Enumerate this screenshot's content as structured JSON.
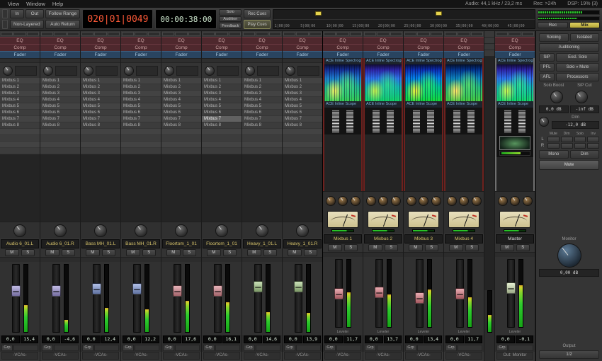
{
  "menubar": {
    "items": [
      "View",
      "Window",
      "Help"
    ],
    "status_audio": "Audio: 44,1 kHz / 23,2 ms",
    "status_rec": "Rec: >24h",
    "status_dsp": "DSP: 19% (3)"
  },
  "toolbar": {
    "punch_in": "In",
    "punch_out": "Out",
    "follow_range": "Follow Range",
    "non_layered": "Non-Layered",
    "auto_return": "Auto Return",
    "primary_clock": "020|01|0049",
    "secondary_clock": "00:00:38:00",
    "solo": "Solo",
    "audition": "Audition",
    "feedback": "Feedback",
    "rec_cues": "Rec Cues",
    "play_cues": "Play Cues",
    "rec_button": "Rec",
    "mix_button": "Mix",
    "ruler_ticks": [
      "1|00|00",
      "5|00|00",
      "10|00|00",
      "15|00|00",
      "20|00|00",
      "25|00|00",
      "30|00|00",
      "35|00|00",
      "40|00|00",
      "45|00|00"
    ]
  },
  "strip_labels": {
    "eq": "EQ",
    "comp": "Comp",
    "fader": "Fader",
    "mute": "M",
    "solo": "S",
    "grp": "Grp",
    "vca": "-VCAs-",
    "gain": "0,0",
    "spectrogram": "ACE Inline Spectrogram",
    "scope": "ACE Inline Scope",
    "leveler": "Leveler"
  },
  "sends": [
    "Mixbus 1",
    "Mixbus 2",
    "Mixbus 3",
    "Mixbus 4",
    "Mixbus 5",
    "Mixbus 6",
    "Mixbus 7",
    "Mixbus 8",
    "",
    "",
    "",
    ""
  ],
  "audio_strips": [
    {
      "name": "Audio 6_01.L",
      "peak": "15,4",
      "cap": "#9a90d4",
      "meter": 40,
      "fader": 30,
      "sel_slot": -1
    },
    {
      "name": "Audio 6_01.R",
      "peak": "-4,6",
      "cap": "#9a90d4",
      "meter": 18,
      "fader": 30,
      "sel_slot": -1
    },
    {
      "name": "Bass MH_01.L",
      "peak": "12,4",
      "cap": "#8098d8",
      "meter": 36,
      "fader": 27,
      "sel_slot": -1
    },
    {
      "name": "Bass MH_01.R",
      "peak": "12,2",
      "cap": "#8098d8",
      "meter": 34,
      "fader": 27,
      "sel_slot": -1
    },
    {
      "name": "Floortom_1_01",
      "peak": "17,6",
      "cap": "#d8838c",
      "meter": 46,
      "fader": 30,
      "sel_slot": -1
    },
    {
      "name": "Floortom_1_01",
      "peak": "16,1",
      "cap": "#d8838c",
      "meter": 44,
      "fader": 30,
      "sel_slot": 6
    },
    {
      "name": "Heavy_1_01.L",
      "peak": "14,6",
      "cap": "#a6cc88",
      "meter": 30,
      "fader": 24,
      "sel_slot": -1
    },
    {
      "name": "Heavy_1_01.R",
      "peak": "13,9",
      "cap": "#a6cc88",
      "meter": 28,
      "fader": 24,
      "sel_slot": -1
    }
  ],
  "bus_strips": [
    {
      "type": "bus",
      "name": "Mixbus 1",
      "peak": "11,7",
      "cap": "#dc7680",
      "meter": 52,
      "fader": 42
    },
    {
      "type": "bus",
      "name": "Mixbus 2",
      "peak": "13,7",
      "cap": "#dc7680",
      "meter": 48,
      "fader": 40
    },
    {
      "type": "bus",
      "name": "Mixbus 3",
      "peak": "13,4",
      "cap": "#dc7680",
      "meter": 56,
      "fader": 48
    },
    {
      "type": "bus",
      "name": "Mixbus 4",
      "peak": "11,7",
      "cap": "#dc7680",
      "meter": 44,
      "fader": 42
    },
    {
      "type": "narrow"
    },
    {
      "type": "master",
      "name": "Master",
      "peak": "-0,1",
      "cap": "#d2e4b4",
      "meter": 62,
      "fader": 34,
      "out": "Out: Monitor"
    }
  ],
  "monitor": {
    "soloing": "Soloing",
    "isolated": "Isolated",
    "auditioning": "Auditioning",
    "sip": "SiP",
    "excl_solo": "Excl. Solo",
    "pfl": "PFL",
    "solo_mute": "Solo » Mute",
    "afl": "AFL",
    "processors": "Processors",
    "solo_boost_label": "Solo Boost",
    "sip_cut_label": "SiP Cut",
    "solo_boost_value": "0,0 dB",
    "sip_cut_value": "-inf dB",
    "dim_label": "Dim",
    "dim_value": "-12,0 dB",
    "matrix_cols": [
      "Mute",
      "Dim",
      "Solo",
      "Inv"
    ],
    "channels": [
      "L",
      "R"
    ],
    "mono": "Mono",
    "dim_button": "Dim",
    "mute": "Mute",
    "monitor_label": "Monitor",
    "gain_value": "0,00 dB",
    "output_label": "Output",
    "output_value": "1/2"
  }
}
